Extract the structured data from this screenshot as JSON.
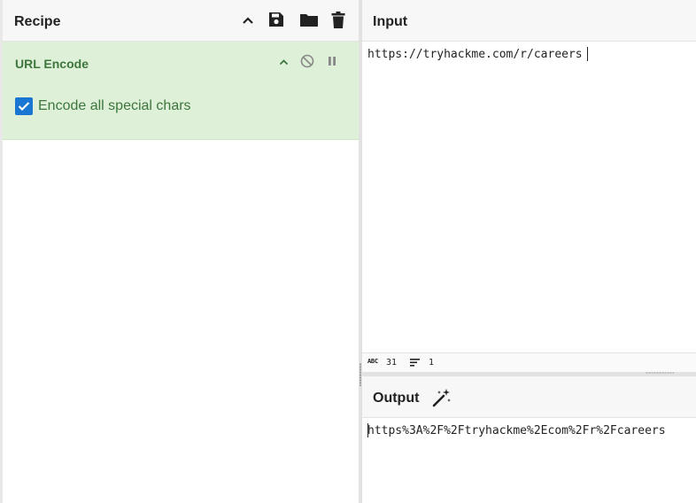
{
  "recipe": {
    "title": "Recipe",
    "operation": {
      "name": "URL Encode",
      "option_label": "Encode all special chars",
      "option_checked": true
    }
  },
  "input": {
    "title": "Input",
    "value": "https://tryhackme.com/r/careers"
  },
  "status": {
    "length_icon_label": "ABC",
    "length": "31",
    "lines": "1"
  },
  "output": {
    "title": "Output",
    "value": "https%3A%2F%2Ftryhackme%2Ecom%2Fr%2Fcareers"
  },
  "colors": {
    "op_background": "#dff0d8",
    "op_text": "#3c763d",
    "checkbox": "#1976d2",
    "header_bg": "#f7f7f7"
  },
  "icons": [
    "chevron-up-icon",
    "save-icon",
    "folder-icon",
    "trash-icon",
    "disable-icon",
    "pause-icon",
    "magic-wand-icon",
    "lines-icon"
  ]
}
